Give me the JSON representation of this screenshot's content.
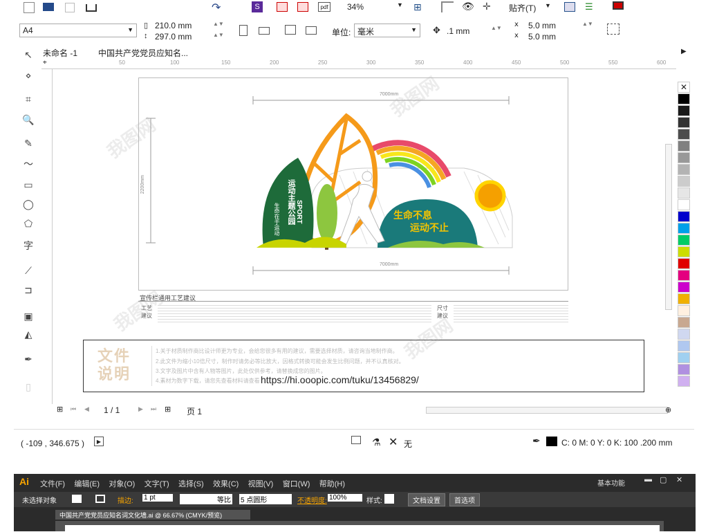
{
  "toolbar_top": {
    "zoom": "34%",
    "snap_label": "贴齐(T)"
  },
  "property_bar": {
    "page_size": "A4",
    "width": "210.0 mm",
    "height": "297.0 mm",
    "units_label": "单位:",
    "units": "毫米",
    "nudge": ".1 mm",
    "dup_x": "5.0 mm",
    "dup_y": "5.0 mm"
  },
  "tabs": {
    "doc1": "未命名 -1",
    "doc2": "中国共产党党员应知名..."
  },
  "ruler": {
    "h_ticks": [
      "50",
      "100",
      "150",
      "200",
      "250",
      "300",
      "350",
      "400",
      "450",
      "500",
      "550",
      "600"
    ]
  },
  "design": {
    "top_dim": "7000mm",
    "bottom_dim": "7000mm",
    "side_dim": "2200mm",
    "leaf_title": "运动主题公园",
    "leaf_sub": "生命在于运动",
    "sport": "SPORT",
    "slogan1": "生命不息",
    "slogan2": "运动不止",
    "craft_title": "宣传栏通用工艺建议",
    "craft_label": "工艺建议",
    "size_label": "尺寸建议"
  },
  "file_note": {
    "label": "文件说明",
    "line1": "1.关于材质制作商比设计师更为专业，会给您很多有用的建议，需要选择材质，请咨询当地制作商。",
    "line2": "2.此文件为缩小10倍尺寸，制作时请务必等比放大，因格式转换可能会发生比例问题，并不认真核对。",
    "line3": "3.文字及图片中含有人物等图片，此处仅供参考，请替换成您的图片。",
    "line4": "4.素材为数字下载，请您先查看材料请查看",
    "url": "https://hi.ooopic.com/tuku/13456829/"
  },
  "page_nav": {
    "counter": "1 / 1",
    "page_label": "页 1"
  },
  "status": {
    "coords": "( -109 , 346.675 )",
    "fill_none": "无",
    "outline": "C: 0 M: 0 Y: 0 K: 100  .200 mm"
  },
  "ai": {
    "logo": "Ai",
    "menus": [
      "文件(F)",
      "编辑(E)",
      "对象(O)",
      "文字(T)",
      "选择(S)",
      "效果(C)",
      "视图(V)",
      "窗口(W)",
      "帮助(H)"
    ],
    "workspace": "基本功能",
    "ctrl_label": "未选择对象",
    "stroke_label": "描边:",
    "stroke_val": "1 pt",
    "line_style": "等比",
    "brush": "5 点圆形",
    "opacity_label": "不透明度:",
    "opacity_val": "100%",
    "style_label": "样式:",
    "doc_setup": "文档设置",
    "prefs": "首选项",
    "doc_tab": "中国共产党党员应知名词文化墙.ai @ 66.67% (CMYK/预览)"
  },
  "palette": [
    "#000000",
    "#1a1a1a",
    "#333333",
    "#4d4d4d",
    "#808080",
    "#999999",
    "#b3b3b3",
    "#cccccc",
    "#e6e6e6",
    "#ffffff",
    "#0000cc",
    "#00a0e9",
    "#00cc66",
    "#ccdd00",
    "#e00000",
    "#e4007f",
    "#cc00cc",
    "#f0b000",
    "#fff0e0",
    "#c8a890",
    "#d0d8f0",
    "#b0c8f0",
    "#a0d0f0",
    "#b090e0",
    "#d0b0f0"
  ]
}
